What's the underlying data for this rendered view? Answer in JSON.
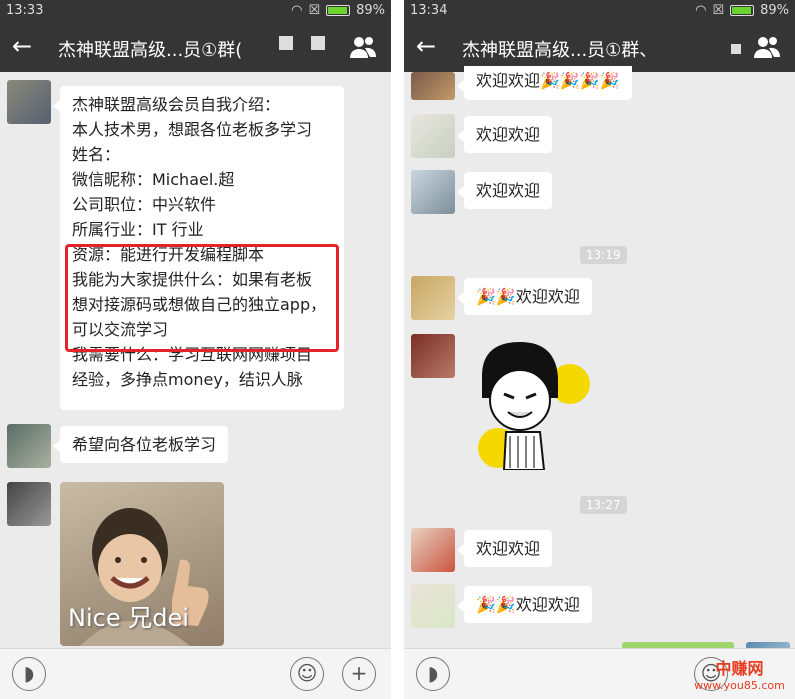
{
  "left": {
    "status": {
      "time": "13:33",
      "battery": "89%"
    },
    "title": "杰神联盟高级...员①群(",
    "intro_lines": [
      "杰神联盟高级会员自我介绍：",
      "本人技术男，想跟各位老板多学习",
      "姓名：",
      "微信昵称：Michael.超",
      "公司职位：中兴软件",
      "所属行业：IT 行业"
    ],
    "highlight_lines": [
      "资源：能进行开发编程脚本",
      "我能为大家提供什么：如果有老板",
      "想对接源码或想做自己的独立app，",
      "可以交流学习"
    ],
    "need_lines": [
      "我需要什么：学习互联网网赚项目",
      "经验，多挣点money，结识人脉"
    ],
    "message2": "希望向各位老板学习",
    "image_caption": "Nice 兄dei",
    "icons": {
      "back": "back-arrow-icon",
      "members": "group-members-icon",
      "voice": "voice-icon",
      "emoji": "emoji-icon",
      "plus": "plus-icon"
    }
  },
  "right": {
    "status": {
      "time": "13:34",
      "battery": "89%"
    },
    "title": "杰神联盟高级...员①群、",
    "messages": [
      {
        "text": "欢迎欢迎🎉🎉🎉🎉"
      },
      {
        "text": "欢迎欢迎"
      },
      {
        "text": "欢迎欢迎"
      },
      {
        "text": "🎉🎉欢迎欢迎"
      },
      {
        "text": "欢迎欢迎"
      },
      {
        "text": "🎉🎉欢迎欢迎"
      }
    ],
    "time1": "13:19",
    "time2": "13:27",
    "watermark": {
      "name": "中赚网",
      "url": "www.you85.com"
    }
  },
  "colors": {
    "bar": "#353535",
    "chat_bg": "#ebebeb",
    "highlight": "#e4222a",
    "send": "#9ed66b",
    "watermark": "#e63b1f"
  }
}
